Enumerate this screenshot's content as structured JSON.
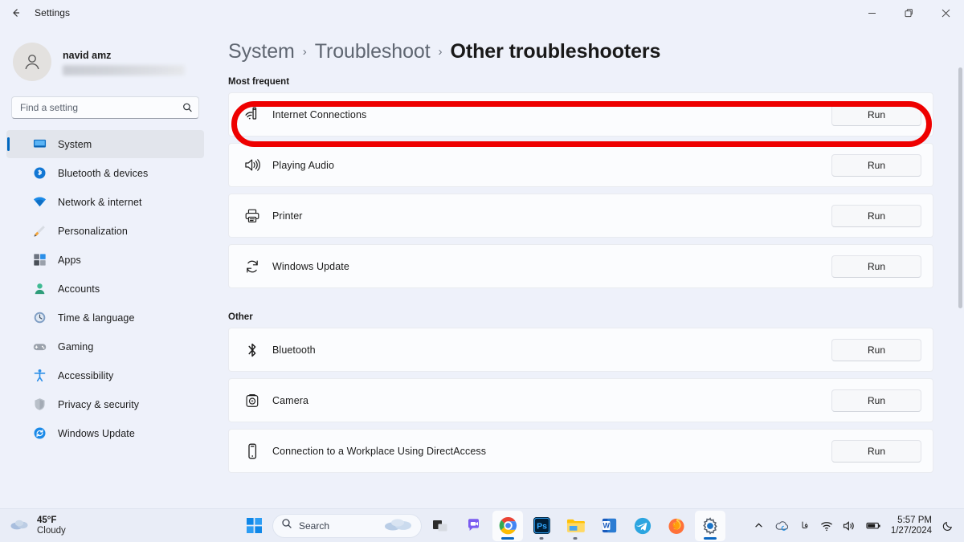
{
  "titlebar": {
    "back_icon": "back-arrow-icon",
    "title": "Settings",
    "minimize_label": "Minimize",
    "maximize_label": "Restore",
    "close_label": "Close"
  },
  "sidebar": {
    "profile": {
      "name": "navid amz",
      "email_redacted": true,
      "avatar_icon": "person-icon"
    },
    "search": {
      "placeholder": "Find a setting",
      "value": "",
      "icon": "search-icon"
    },
    "items": [
      {
        "label": "System",
        "icon": "monitor-icon",
        "selected": true
      },
      {
        "label": "Bluetooth & devices",
        "icon": "bluetooth-icon",
        "selected": false
      },
      {
        "label": "Network & internet",
        "icon": "wifi-icon",
        "selected": false
      },
      {
        "label": "Personalization",
        "icon": "paintbrush-icon",
        "selected": false
      },
      {
        "label": "Apps",
        "icon": "apps-grid-icon",
        "selected": false
      },
      {
        "label": "Accounts",
        "icon": "account-person-icon",
        "selected": false
      },
      {
        "label": "Time & language",
        "icon": "clock-globe-icon",
        "selected": false
      },
      {
        "label": "Gaming",
        "icon": "gamepad-icon",
        "selected": false
      },
      {
        "label": "Accessibility",
        "icon": "accessibility-person-icon",
        "selected": false
      },
      {
        "label": "Privacy & security",
        "icon": "shield-icon",
        "selected": false
      },
      {
        "label": "Windows Update",
        "icon": "update-refresh-icon",
        "selected": false
      }
    ]
  },
  "content": {
    "breadcrumb": [
      {
        "label": "System",
        "current": false
      },
      {
        "label": "Troubleshoot",
        "current": false
      },
      {
        "label": "Other troubleshooters",
        "current": true
      }
    ],
    "breadcrumb_separator": "›",
    "sections": [
      {
        "heading": "Most frequent",
        "rows": [
          {
            "label": "Internet Connections",
            "icon": "internet-signal-icon",
            "action": "Run",
            "highlighted": true
          },
          {
            "label": "Playing Audio",
            "icon": "speaker-icon",
            "action": "Run",
            "highlighted": false
          },
          {
            "label": "Printer",
            "icon": "printer-icon",
            "action": "Run",
            "highlighted": false
          },
          {
            "label": "Windows Update",
            "icon": "refresh-arrows-icon",
            "action": "Run",
            "highlighted": false
          }
        ]
      },
      {
        "heading": "Other",
        "rows": [
          {
            "label": "Bluetooth",
            "icon": "bluetooth-icon",
            "action": "Run",
            "highlighted": false
          },
          {
            "label": "Camera",
            "icon": "camera-icon",
            "action": "Run",
            "highlighted": false
          },
          {
            "label": "Connection to a Workplace Using DirectAccess",
            "icon": "device-icon",
            "action": "Run",
            "highlighted": false
          }
        ]
      }
    ],
    "annotation": {
      "color": "#ee0000",
      "target": "Internet Connections"
    }
  },
  "taskbar": {
    "weather": {
      "temperature": "45°F",
      "condition": "Cloudy",
      "icon": "cloud-icon"
    },
    "start_label": "Start",
    "search": {
      "label": "Search",
      "icon": "search-icon"
    },
    "apps": [
      {
        "name": "task-view",
        "label": "Task View",
        "open": false
      },
      {
        "name": "chat",
        "label": "Chat",
        "open": false
      },
      {
        "name": "chrome",
        "label": "Google Chrome",
        "open": true
      },
      {
        "name": "photoshop",
        "label": "Adobe Photoshop",
        "open": true
      },
      {
        "name": "file-explorer",
        "label": "File Explorer",
        "open": true
      },
      {
        "name": "word",
        "label": "Microsoft Word",
        "open": false
      },
      {
        "name": "telegram",
        "label": "Telegram",
        "open": false
      },
      {
        "name": "firefox",
        "label": "Firefox",
        "open": false
      },
      {
        "name": "settings",
        "label": "Settings",
        "open": true,
        "active": true
      }
    ],
    "tray": {
      "chevron": "chevron-up-icon",
      "onedrive": "onedrive-icon",
      "language": "فا",
      "wifi": "wifi-icon",
      "volume": "volume-icon",
      "battery": "battery-icon",
      "time": "5:57 PM",
      "date": "1/27/2024",
      "notification": "moon-icon"
    }
  },
  "colors": {
    "page_bg": "#eef1fa",
    "card_bg": "#fbfcfe",
    "accent": "#0067c0",
    "annotation_red": "#ee0000",
    "taskbar_bg": "#e9edf7"
  }
}
